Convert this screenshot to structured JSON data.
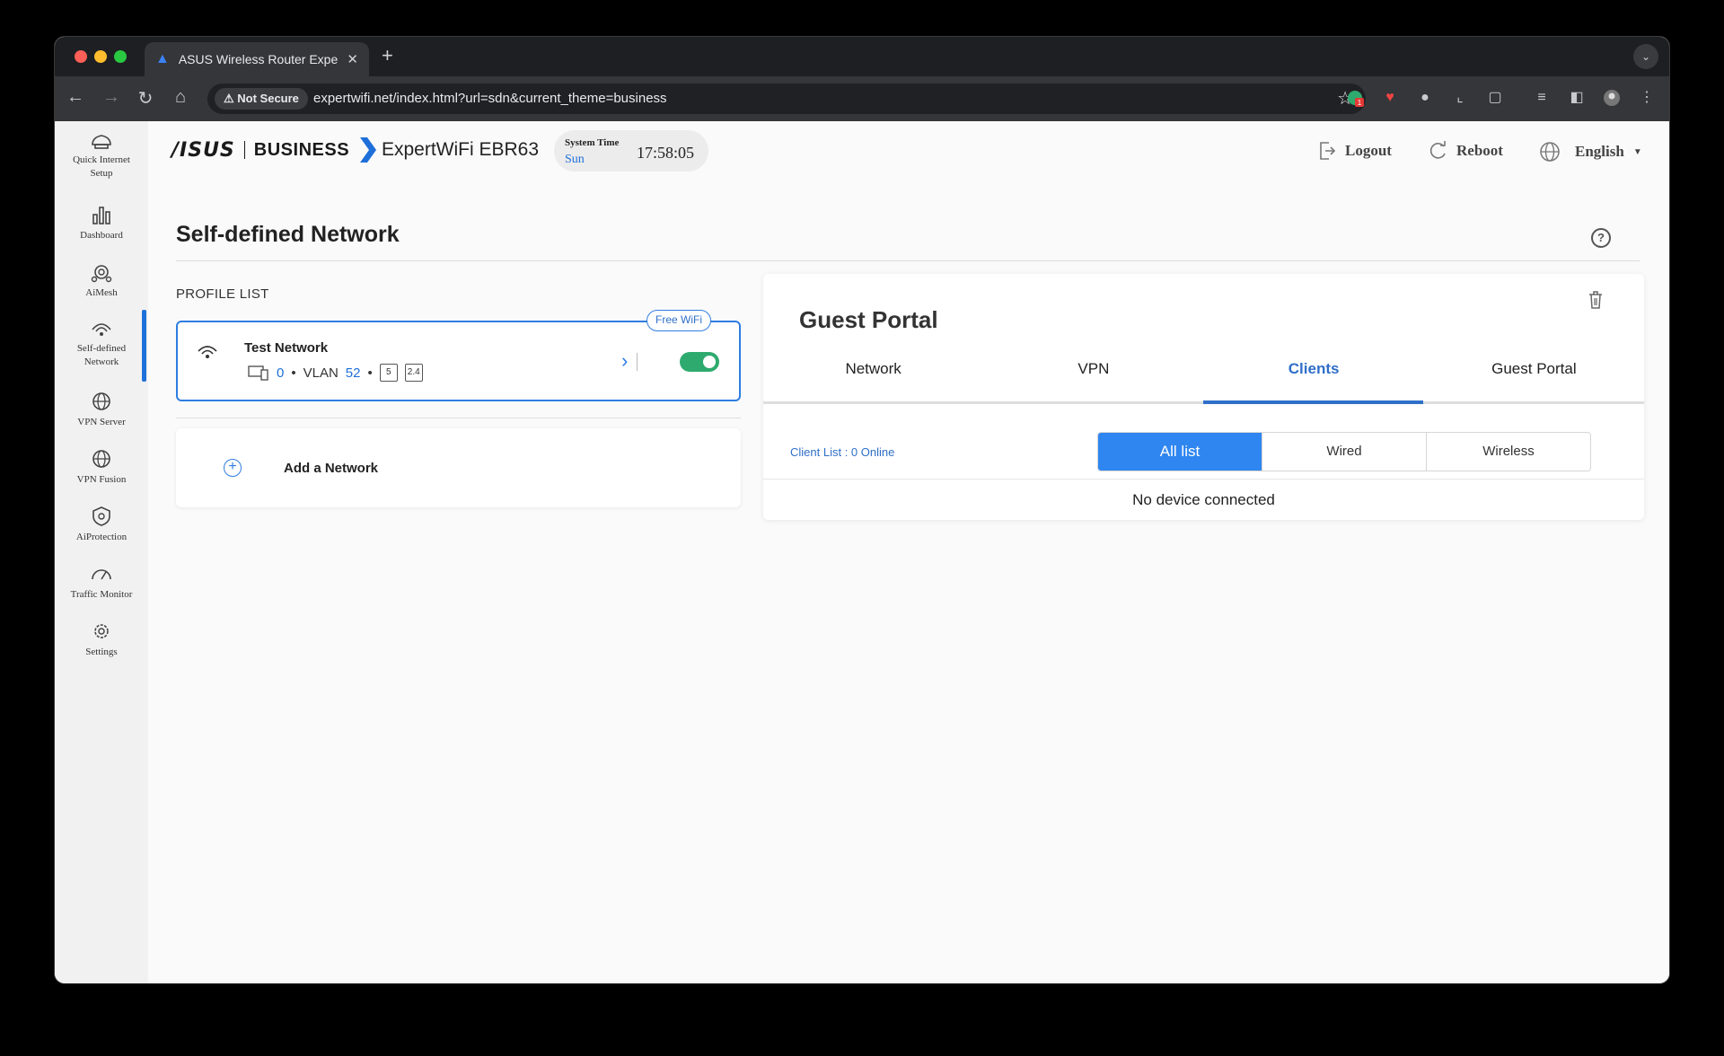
{
  "browser": {
    "tab_title": "ASUS Wireless Router Exper",
    "security_label": "Not Secure",
    "url": "expertwifi.net/index.html?url=sdn&current_theme=business",
    "extension_badge": "1"
  },
  "sidebar": {
    "items": [
      {
        "line1": "Quick Internet",
        "line2": "Setup"
      },
      {
        "line1": "Dashboard"
      },
      {
        "line1": "AiMesh"
      },
      {
        "line1": "Self-defined",
        "line2": "Network"
      },
      {
        "line1": "VPN Server"
      },
      {
        "line1": "VPN Fusion"
      },
      {
        "line1": "AiProtection"
      },
      {
        "line1": "Traffic Monitor"
      },
      {
        "line1": "Settings"
      }
    ]
  },
  "header": {
    "brand_name": "BUSINESS",
    "product": "ExpertWiFi EBR63",
    "system_time_label": "System Time",
    "day": "Sun",
    "time": "17:58:05",
    "logout": "Logout",
    "reboot": "Reboot",
    "language": "English"
  },
  "page": {
    "title": "Self-defined Network",
    "profile_list_label": "PROFILE LIST",
    "profile": {
      "badge": "Free WiFi",
      "name": "Test Network",
      "clients": "0",
      "vlan_label": "VLAN",
      "vlan_id": "52",
      "bands": [
        "5",
        "2.4"
      ],
      "enabled": true
    },
    "add_network": "Add a Network"
  },
  "detail": {
    "title": "Guest Portal",
    "tabs": [
      "Network",
      "VPN",
      "Clients",
      "Guest Portal"
    ],
    "active_tab": "Clients",
    "client_list": "Client List : 0 Online",
    "filters": [
      "All list",
      "Wired",
      "Wireless"
    ],
    "active_filter": "All list",
    "empty_message": "No device connected"
  },
  "colors": {
    "accent": "#2f6fc8",
    "toggle_on": "#2eaa6e",
    "segment_active": "#2f86f0"
  }
}
